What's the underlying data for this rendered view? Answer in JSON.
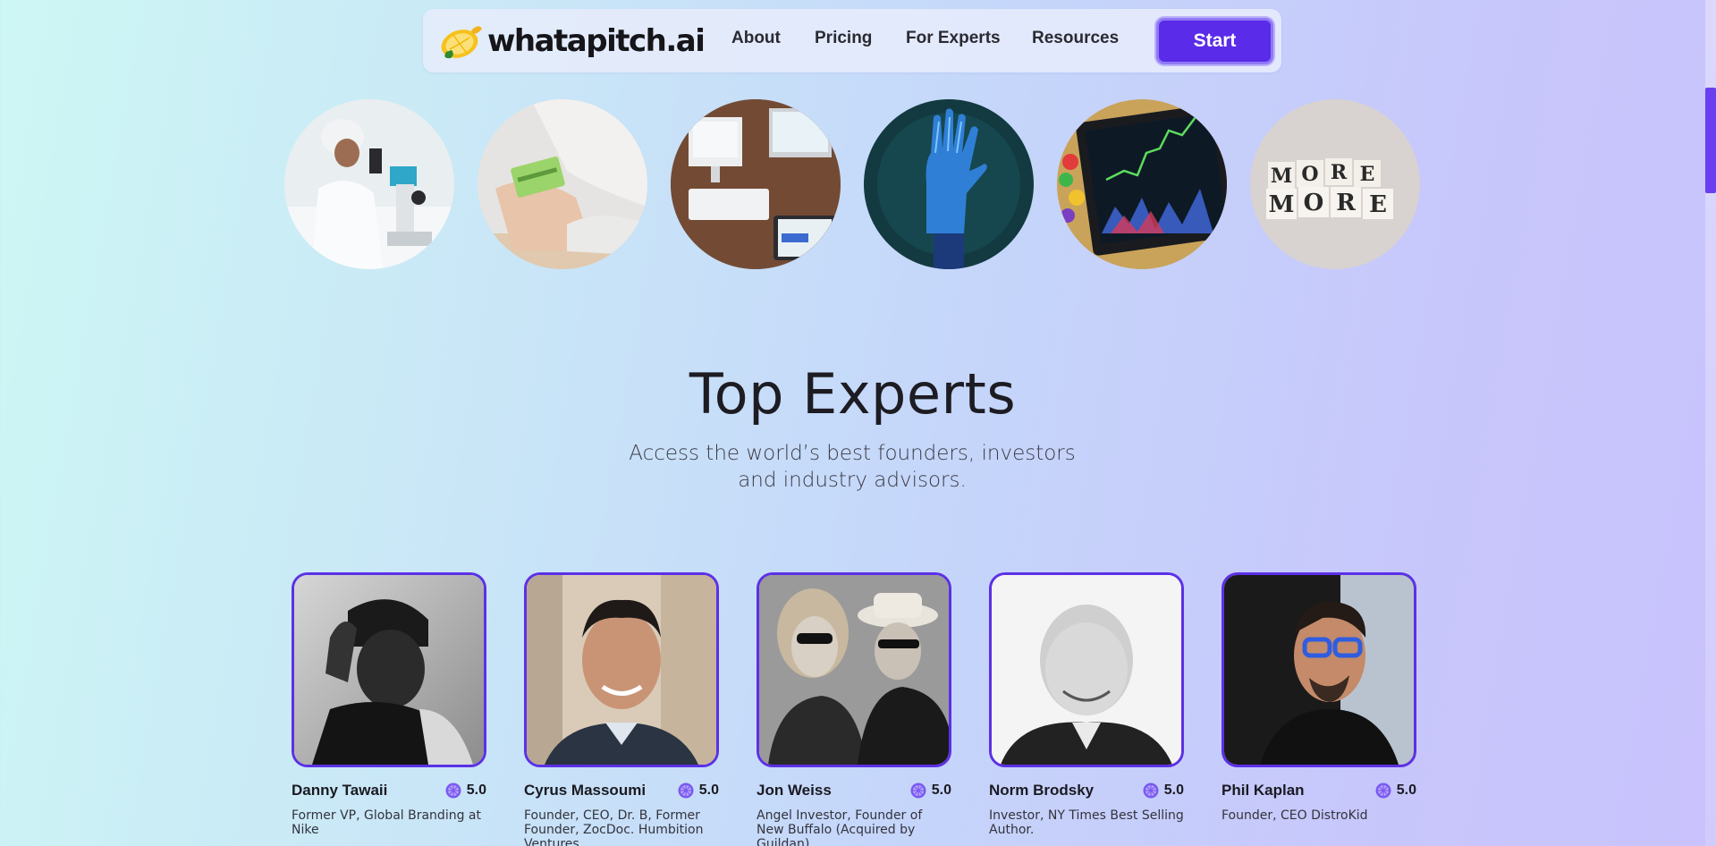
{
  "nav": {
    "logo_text": "whatapitch.ai",
    "links": [
      "About",
      "Pricing",
      "For Experts",
      "Resources"
    ],
    "start_label": "Start"
  },
  "categories": [
    {
      "icon": "scientist-microscope-image"
    },
    {
      "icon": "credit-card-image"
    },
    {
      "icon": "computer-desk-image"
    },
    {
      "icon": "robot-hand-image"
    },
    {
      "icon": "stock-chart-image"
    },
    {
      "icon": "more-blocks-image"
    }
  ],
  "section": {
    "title": "Top Experts",
    "subtitle_line1": "Access the world’s best founders, investors",
    "subtitle_line2": "and industry advisors."
  },
  "experts": [
    {
      "name": "Danny Tawaii",
      "rating": "5.0",
      "desc": "Former VP, Global Branding at Nike"
    },
    {
      "name": "Cyrus Massoumi",
      "rating": "5.0",
      "desc": "Founder, CEO, Dr. B, Former Founder, ZocDoc. Humbition Ventures"
    },
    {
      "name": "Jon Weiss",
      "rating": "5.0",
      "desc": "Angel Investor, Founder of New Buffalo (Acquired by Guildan)"
    },
    {
      "name": "Norm Brodsky",
      "rating": "5.0",
      "desc": "Investor, NY Times Best Selling Author."
    },
    {
      "name": "Phil Kaplan",
      "rating": "5.0",
      "desc": "Founder, CEO DistroKid"
    }
  ],
  "colors": {
    "accent": "#5a2be8",
    "card_border": "#5c30e6"
  }
}
